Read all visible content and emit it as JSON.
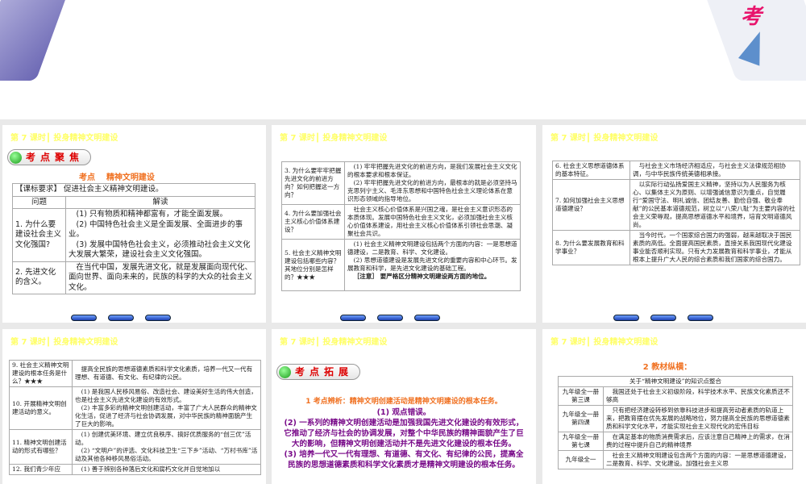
{
  "slide_title": "第 7 课时┃ 投身精神文明建设",
  "top_slide": {
    "deco_text": "考"
  },
  "s1": {
    "badge": "考点聚焦",
    "heading_a": "考点",
    "heading_b": "精神文明建设",
    "req_label": "【课标要求】",
    "req": "促进社会主义精神文明建设。",
    "col1": "问题",
    "col2": "解读",
    "rows": [
      {
        "q": "1. 为什么要建设社会主义文化强国?",
        "a": [
          "(1) 只有物质和精神都富有，才能全面发展。",
          "(2) 中国特色社会主义是全面发展、全面进步的事业。",
          "(3) 发展中国特色社会主义，必须推动社会主义文化大发展大繁荣，建设社会主义文化强国。"
        ]
      },
      {
        "q": "2. 先进文化的含义。",
        "a": [
          "在当代中国，发展先进文化，就是发展面向现代化、面向世界、面向未来的，民族的科学的大众的社会主义文化。"
        ]
      }
    ]
  },
  "s2": {
    "rows": [
      {
        "q": "3. 为什么要牢牢把握先进文化的前进方向？如何把握这一方向？",
        "a": [
          "(1) 牢牢把握先进文化的前进方向，是我们发展社会主义文化的根本要求和根本保证。",
          "(2) 牢牢把握先进文化的前进方向，最根本的就是必须坚持马克思列宁主义、毛泽东思想和中国特色社会主义理论体系在意识形态领域的指导地位。"
        ]
      },
      {
        "q": "4. 为什么要加强社会主义核心价值体系建设？",
        "a": [
          "社会主义核心价值体系是兴国之魂，是社会主义意识形态的本质体现。发展中国特色社会主义文化，必须加强社会主义核心价值体系建设，用社会主义核心价值体系引领社会思潮、凝聚社会共识。"
        ]
      },
      {
        "q": "5. 社会主义精神文明建设包括哪些内容？其地位分别是怎样的？★★★",
        "a": [
          "(1) 社会主义精神文明建设包括两个方面的内容：一是思想道德建设，二是教育、科学、文化建设。",
          "(2) 思想道德建设是发展先进文化的重要内容和中心环节。发展教育和科学，是先进文化建设的基础工程。"
        ],
        "note": "［注意］ 要严格区分精神文明建设两方面的地位。"
      }
    ]
  },
  "s3": {
    "rows": [
      {
        "q": "6. 社会主义思想道德体系的基本特征。",
        "a": [
          "与社会主义市场经济相适应，与社会主义法律规范相协调，与中华民族传统美德相承接。"
        ]
      },
      {
        "q": "7. 如何加强社会主义思想道德建设？",
        "a": [
          "以实际行动弘扬爱国主义精神，坚持以为人民服务为核心、以集体主义为原则、以增强诚信意识为重点，自觉履行“爱国守法、明礼诚信、团结友善、勤俭自强、敬业奉献”的公民基本道德规范，树立以“八荣八耻”为主要内容的社会主义荣辱观，提高思想道德水平和境界，培育文明道德风尚。"
        ]
      },
      {
        "q": "8. 为什么要发展教育和科学事业？",
        "a": [
          "当今时代，一个国家综合国力的强弱，越来越取决于国民素质的高低。全面提高国民素质，直接关系我国现代化建设事业能否顺利实现。只有大力发展教育和科学事业，才能从根本上提升广大人民的综合素质和我们国家的综合国力。"
        ]
      }
    ]
  },
  "s4": {
    "rows": [
      {
        "q": "9. 社会主义精神文明建设的根本任务是什么？★★★",
        "a": [
          "提高全民族的思想道德素质和科学文化素质，培养一代又一代有理想、有道德、有文化、有纪律的公民。"
        ]
      },
      {
        "q": "10. 开展精神文明创建活动的意义。",
        "a": [
          "(1) 是我国人民移风易俗、改造社会、建设美好生活的伟大创造，也是社会主义先进文化建设的有效形式。",
          "(2) 丰富多彩的精神文明创建活动，丰富了广大人民群众的精神文化生活，促进了经济与社会协调发展，对中华民族的精神面貌产生了巨大的影响。"
        ]
      },
      {
        "q": "11. 精神文明创建活动的形式有哪些？",
        "a": [
          "(1) 创建优美环境、建立优良秩序、搞好优质服务的“创三优”活动。",
          "(2) “文明户”的评选、文化科技卫生“三下乡”活动、“万村书库”活动及其他各种移风易俗活动。"
        ]
      },
      {
        "q": "12. 我们青少年应",
        "a": [
          "(1) 善于辨别各种落后文化和腐朽文化并自觉地加以"
        ]
      }
    ]
  },
  "s5": {
    "badge": "考点拓展",
    "l1": "1 考点辨析：精神文明创建活动是精神文明建设的根本任务。",
    "l2": "(1) 观点错误。",
    "l3": "(2) 一系列的精神文明创建活动是加强我国先进文化建设的有效形式，它推动了经济与社会的协调发展，对整个中华民族的精神面貌产生了巨大的影响，但精神文明创建活动并不是先进文化建设的根本任务。",
    "l4": "(3) 培养一代又一代有理想、有道德、有文化、有纪律的公民，提高全民族的思想道德素质和科学文化素质才是精神文明建设的根本任务。"
  },
  "s6": {
    "heading": "2 教材纵横：",
    "table_title": "关于“精神文明建设”的知识点整合",
    "rows": [
      {
        "q": "九年级全一册第三课",
        "a": "我国还处于社会主义初级阶段，科学技术水平、民族文化素质还不够高"
      },
      {
        "q": "九年级全一册第四课",
        "a": "只有把经济建设转移到依靠科技进步和提高劳动者素质的轨道上来，把教育摆在优先发展的战略地位，努力提高全民族的思想道德素质和科学文化水平，才能实现社会主义现代化的宏伟目标"
      },
      {
        "q": "九年级全一册第七课",
        "a": "在满足基本的物质消费需求后，应该注意自己精神上的需求，在消费的过程中提升自己的精神境界"
      },
      {
        "q": "九年级全一",
        "a": "社会主义精神文明建设包含两个方面的内容：一是思想道德建设，二是教育、科学、文化建设。加强社会主义思"
      }
    ]
  }
}
